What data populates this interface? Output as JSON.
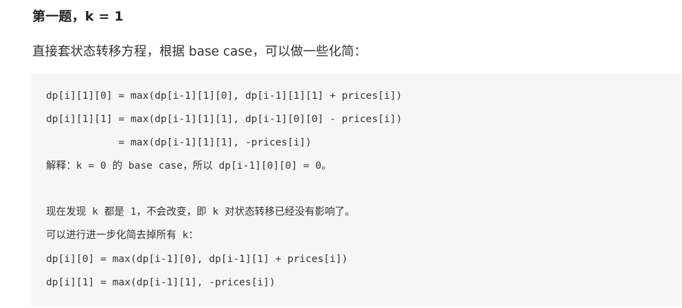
{
  "heading": "第一题，k = 1",
  "intro": "直接套状态转移方程，根据 base case，可以做一些化简：",
  "code_lines": [
    "dp[i][1][0] = max(dp[i-1][1][0], dp[i-1][1][1] + prices[i])",
    "dp[i][1][1] = max(dp[i-1][1][1], dp[i-1][0][0] - prices[i])",
    "            = max(dp[i-1][1][1], -prices[i])",
    "解释：k = 0 的 base case，所以 dp[i-1][0][0] = 0。",
    "现在发现 k 都是 1，不会改变，即 k 对状态转移已经没有影响了。",
    "可以进行进一步化简去掉所有 k：",
    "dp[i][0] = max(dp[i-1][0], dp[i-1][1] + prices[i])",
    "dp[i][1] = max(dp[i-1][1], -prices[i])"
  ]
}
